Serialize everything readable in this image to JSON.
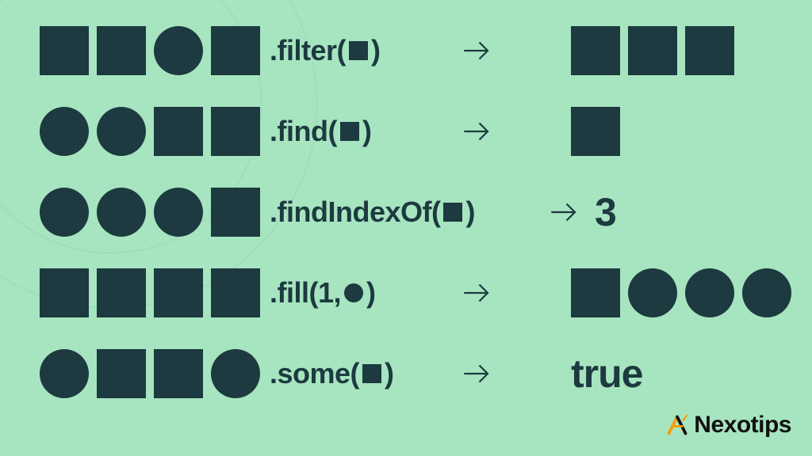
{
  "colors": {
    "bg": "#a7e4c0",
    "dark": "#1c3a3f",
    "logoAccent": "#f59e0b"
  },
  "rows": [
    {
      "input": [
        "square",
        "square",
        "circle",
        "square"
      ],
      "method": {
        "prefix": ".filter(",
        "argShape": "square",
        "suffix": ")"
      },
      "methodWidth": 240,
      "arrowWidth": 140,
      "output": {
        "type": "shapes",
        "shapes": [
          "square",
          "square",
          "square"
        ]
      }
    },
    {
      "input": [
        "circle",
        "circle",
        "square",
        "square"
      ],
      "method": {
        "prefix": ".find(",
        "argShape": "square",
        "suffix": ")"
      },
      "methodWidth": 240,
      "arrowWidth": 140,
      "output": {
        "type": "shapes",
        "shapes": [
          "square"
        ]
      }
    },
    {
      "input": [
        "circle",
        "circle",
        "circle",
        "square"
      ],
      "method": {
        "prefix": ".findIndexOf(",
        "argShape": "square",
        "suffix": ")"
      },
      "methodWidth": 350,
      "arrowWidth": 60,
      "output": {
        "type": "text",
        "value": "3"
      }
    },
    {
      "input": [
        "square",
        "square",
        "square",
        "square"
      ],
      "method": {
        "prefix": ".fill(1,",
        "argShape": "circle",
        "suffix": ")"
      },
      "methodWidth": 240,
      "arrowWidth": 140,
      "output": {
        "type": "shapes",
        "shapes": [
          "square",
          "circle",
          "circle",
          "circle"
        ]
      }
    },
    {
      "input": [
        "circle",
        "square",
        "square",
        "circle"
      ],
      "method": {
        "prefix": ".some(",
        "argShape": "square",
        "suffix": ")"
      },
      "methodWidth": 240,
      "arrowWidth": 140,
      "output": {
        "type": "text",
        "value": "true"
      }
    }
  ],
  "logo": {
    "text": "Nexotips"
  }
}
